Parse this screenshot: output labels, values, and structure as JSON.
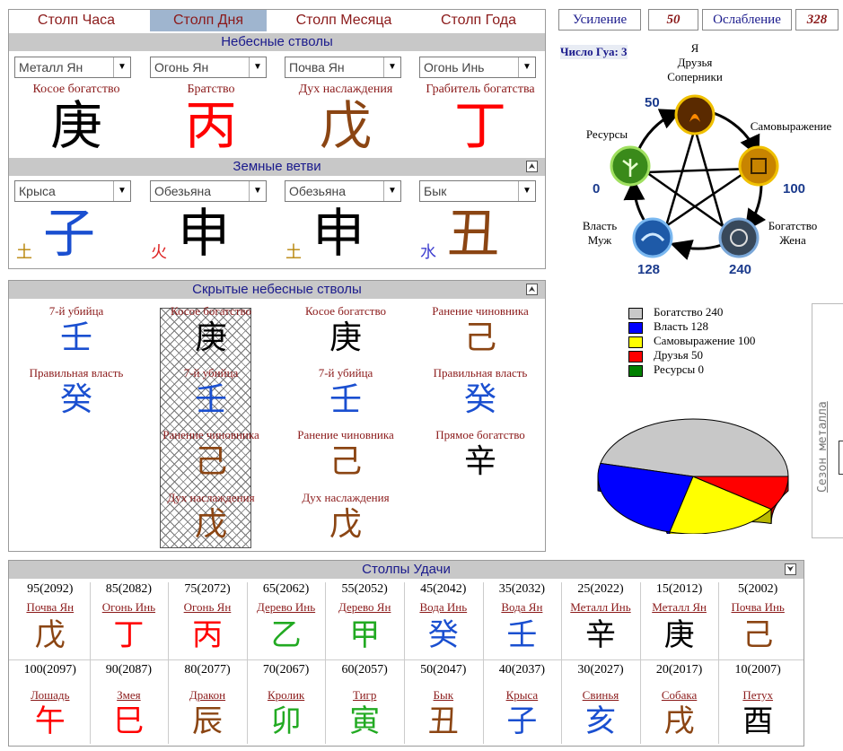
{
  "pillars": {
    "headers": [
      "Столп Часа",
      "Столп Дня",
      "Столп Месяца",
      "Столп Года"
    ],
    "selected_header_index": 1,
    "heavenly_title": "Небесные стволы",
    "heavenly_selects": [
      "Металл Ян",
      "Огонь Ян",
      "Почва Ян",
      "Огонь Инь"
    ],
    "heavenly_labels": [
      "Косое богатство",
      "Братство",
      "Дух наслаждения",
      "Грабитель богатства"
    ],
    "heavenly_hanzi": [
      "庚",
      "丙",
      "戊",
      "丁"
    ],
    "heavenly_colors": [
      "#000000",
      "#ff0000",
      "#8b4513",
      "#ff0000"
    ],
    "earthly_title": "Земные ветви",
    "earthly_selects": [
      "Крыса",
      "Обезьяна",
      "Обезьяна",
      "Бык"
    ],
    "earthly_small": [
      "土",
      "火",
      "土",
      "水"
    ],
    "earthly_small_colors": [
      "#b8860b",
      "#d22",
      "#b8860b",
      "#4040d0"
    ],
    "earthly_hanzi": [
      "子",
      "申",
      "申",
      "丑"
    ],
    "earthly_colors": [
      "#1a4fd0",
      "#000000",
      "#000000",
      "#8b4513"
    ],
    "collapse_glyph": "⮝"
  },
  "hidden": {
    "title": "Скрытые небесные стволы",
    "columns": [
      {
        "items": [
          {
            "label": "7-й убийца",
            "hz": "壬",
            "color": "#1a4fd0"
          },
          {
            "label": "Правильная власть",
            "hz": "癸",
            "color": "#1a4fd0"
          }
        ]
      },
      {
        "items": [
          {
            "label": "Косое богатство",
            "hz": "庚",
            "color": "#000000"
          },
          {
            "label": "7-й убийца",
            "hz": "壬",
            "color": "#1a4fd0"
          },
          {
            "label": "Ранение чиновника",
            "hz": "己",
            "color": "#8b4513"
          },
          {
            "label": "Дух наслаждения",
            "hz": "戊",
            "color": "#8b4513"
          }
        ]
      },
      {
        "items": [
          {
            "label": "Косое богатство",
            "hz": "庚",
            "color": "#000000"
          },
          {
            "label": "7-й убийца",
            "hz": "壬",
            "color": "#1a4fd0"
          },
          {
            "label": "Ранение чиновника",
            "hz": "己",
            "color": "#8b4513"
          },
          {
            "label": "Дух наслаждения",
            "hz": "戊",
            "color": "#8b4513"
          }
        ]
      },
      {
        "items": [
          {
            "label": "Ранение чиновника",
            "hz": "己",
            "color": "#8b4513"
          },
          {
            "label": "Правильная власть",
            "hz": "癸",
            "color": "#1a4fd0"
          },
          {
            "label": "Прямое богатство",
            "hz": "辛",
            "color": "#000000"
          }
        ]
      }
    ]
  },
  "strength": {
    "gain_label": "Усиление",
    "gain_value": "50",
    "loss_label": "Ослабление",
    "loss_value": "328"
  },
  "gua": "Число Гуа: 3",
  "wheel": {
    "self_label": "Я\nДрузья\nСоперники",
    "expression_label": "Самовыражение",
    "wealth_label": "Богатство\nЖена",
    "power_label": "Власть\nМуж",
    "resources_label": "Ресурсы",
    "num_self": "50",
    "num_expression": "100",
    "num_wealth": "240",
    "num_power": "128",
    "num_resources": "0"
  },
  "chart_data": {
    "type": "pie",
    "categories": [
      "Богатство",
      "Власть",
      "Самовыражение",
      "Друзья",
      "Ресурсы"
    ],
    "values": [
      240,
      128,
      100,
      50,
      0
    ],
    "colors": [
      "#c8c8c8",
      "#0000ff",
      "#ffff00",
      "#ff0000",
      "#008000"
    ],
    "legend": [
      "Богатство  240",
      "Власть  128",
      "Самовыражение  100",
      "Друзья  50",
      "Ресурсы  0"
    ]
  },
  "season": "Сезон металла",
  "luck": {
    "title": "Столпы Удачи",
    "collapse_glyph": "⮟",
    "top_years": [
      "95(2092)",
      "85(2082)",
      "75(2072)",
      "65(2062)",
      "55(2052)",
      "45(2042)",
      "35(2032)",
      "25(2022)",
      "15(2012)",
      "5(2002)"
    ],
    "stem_names": [
      "Почва Ян",
      "Огонь Инь",
      "Огонь Ян",
      "Дерево Инь",
      "Дерево Ян",
      "Вода Инь",
      "Вода Ян",
      "Металл Инь",
      "Металл Ян",
      "Почва Инь"
    ],
    "stem_hz": [
      "戊",
      "丁",
      "丙",
      "乙",
      "甲",
      "癸",
      "壬",
      "辛",
      "庚",
      "己"
    ],
    "stem_colors": [
      "#8b4513",
      "#ff0000",
      "#ff0000",
      "#22aa22",
      "#22aa22",
      "#1a4fd0",
      "#1a4fd0",
      "#000000",
      "#000000",
      "#8b4513"
    ],
    "bottom_years": [
      "100(2097)",
      "90(2087)",
      "80(2077)",
      "70(2067)",
      "60(2057)",
      "50(2047)",
      "40(2037)",
      "30(2027)",
      "20(2017)",
      "10(2007)"
    ],
    "branch_names": [
      "Лошадь",
      "Змея",
      "Дракон",
      "Кролик",
      "Тигр",
      "Бык",
      "Крыса",
      "Свинья",
      "Собака",
      "Петух"
    ],
    "branch_hz": [
      "午",
      "巳",
      "辰",
      "卯",
      "寅",
      "丑",
      "子",
      "亥",
      "戌",
      "酉"
    ],
    "branch_colors": [
      "#ff0000",
      "#ff0000",
      "#8b4513",
      "#22aa22",
      "#22aa22",
      "#8b4513",
      "#1a4fd0",
      "#1a4fd0",
      "#8b4513",
      "#000000"
    ]
  }
}
